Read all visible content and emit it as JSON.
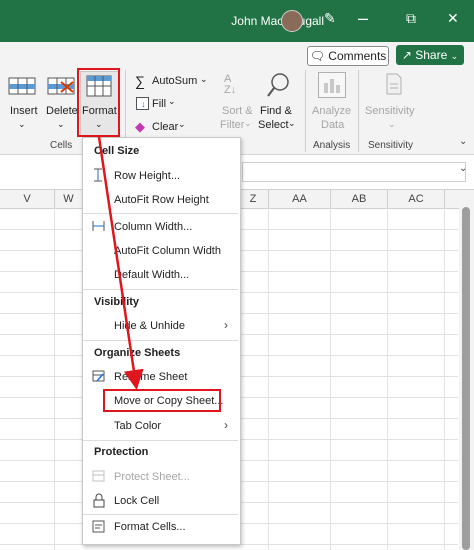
{
  "titlebar": {
    "user": "John MacDougall"
  },
  "header": {
    "comments": "Comments",
    "share": "Share"
  },
  "ribbon": {
    "insert": "Insert",
    "delete": "Delete",
    "format": "Format",
    "autosum": "AutoSum",
    "fill": "Fill",
    "clear": "Clear",
    "sort_filter_1": "Sort &",
    "sort_filter_2": "Filter",
    "find_select_1": "Find &",
    "find_select_2": "Select",
    "analyze_1": "Analyze",
    "analyze_2": "Data",
    "sensitivity": "Sensitivity",
    "group_cells": "Cells",
    "group_analysis": "Analysis",
    "group_sensitivity": "Sensitivity"
  },
  "columns": [
    "V",
    "W",
    "Z",
    "AA",
    "AB",
    "AC"
  ],
  "menu": {
    "cell_size": "Cell Size",
    "row_height": "Row Height...",
    "autofit_row": "AutoFit Row Height",
    "column_width": "Column Width...",
    "autofit_column": "AutoFit Column Width",
    "default_width": "Default Width...",
    "visibility": "Visibility",
    "hide_unhide": "Hide & Unhide",
    "organize": "Organize Sheets",
    "rename": "Rename Sheet",
    "move_copy": "Move or Copy Sheet...",
    "tab_color": "Tab Color",
    "protection": "Protection",
    "protect_sheet": "Protect Sheet...",
    "lock_cell": "Lock Cell",
    "format_cells": "Format Cells..."
  },
  "colors": {
    "excel_green": "#217346",
    "highlight_red": "#e0161e"
  }
}
